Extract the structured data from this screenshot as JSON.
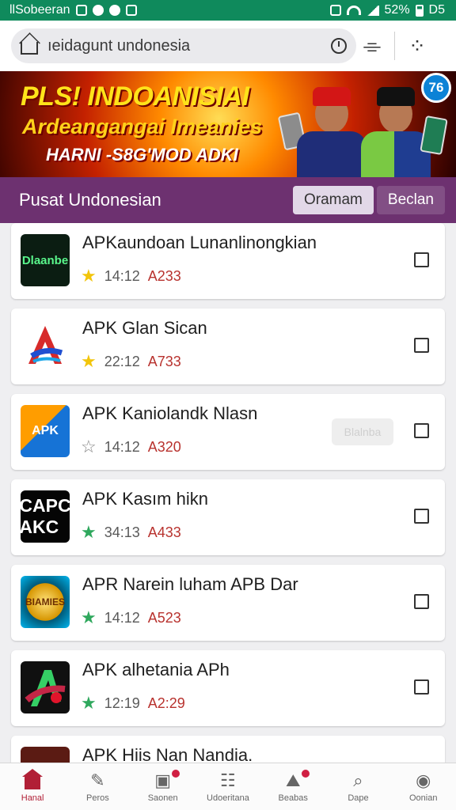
{
  "status_bar": {
    "left_text": "llSobeeran",
    "right_text": "52%",
    "right_extra": "D5"
  },
  "browser": {
    "url": "ıeidagunt undonesia"
  },
  "banner": {
    "line1": "PLS! INDOANISIAI",
    "line2": "Ardeangangai Imeanies",
    "line3": "HARNI -S8G'MOD ADKI"
  },
  "section": {
    "title": "Pusat Undonesian",
    "tabs": [
      {
        "label": "Oramam"
      },
      {
        "label": "Beclan"
      }
    ]
  },
  "apps": [
    {
      "name": "APKaundoan Lunanlinongkian",
      "icon_label": "Dlaanbe",
      "rating": "14:12",
      "price": "A233",
      "star": "yellow"
    },
    {
      "name": "APK Glan Sican",
      "icon_label": "A",
      "rating": "22:12",
      "price": "A733",
      "star": "yellow"
    },
    {
      "name": "APK Kaniolandk Nlasn",
      "icon_label": "APK",
      "rating": "14:12",
      "price": "A320",
      "star": "outline",
      "ghost": "Blalnba"
    },
    {
      "name": "APK Kasım hikn",
      "icon_label": "CAPC AKC",
      "rating": "34:13",
      "price": "A433",
      "star": "green"
    },
    {
      "name": "APR Narein luham APB Dar",
      "icon_label": "BIAMIES",
      "rating": "14:12",
      "price": "A523",
      "star": "green"
    },
    {
      "name": "APK alhetania APh",
      "icon_label": "A",
      "rating": "12:19",
      "price": "A2:29",
      "star": "green"
    },
    {
      "name": "APK Hiis Nan Nandia.",
      "icon_label": "",
      "rating": "",
      "price": "",
      "star": "none"
    }
  ],
  "bottom_nav": [
    {
      "label": "Hanal",
      "icon": "home-icon"
    },
    {
      "label": "Peros",
      "icon": "pen-icon"
    },
    {
      "label": "Saonen",
      "icon": "search-badge-icon"
    },
    {
      "label": "Udoeritana",
      "icon": "grid-icon"
    },
    {
      "label": "Beabas",
      "icon": "image-icon"
    },
    {
      "label": "Dape",
      "icon": "search-icon"
    },
    {
      "label": "Oonian",
      "icon": "profile-icon"
    }
  ],
  "colors": {
    "status_green": "#0f8a5c",
    "header_purple": "#6d3170",
    "price_red": "#b8322e",
    "active_nav": "#b11f36"
  }
}
